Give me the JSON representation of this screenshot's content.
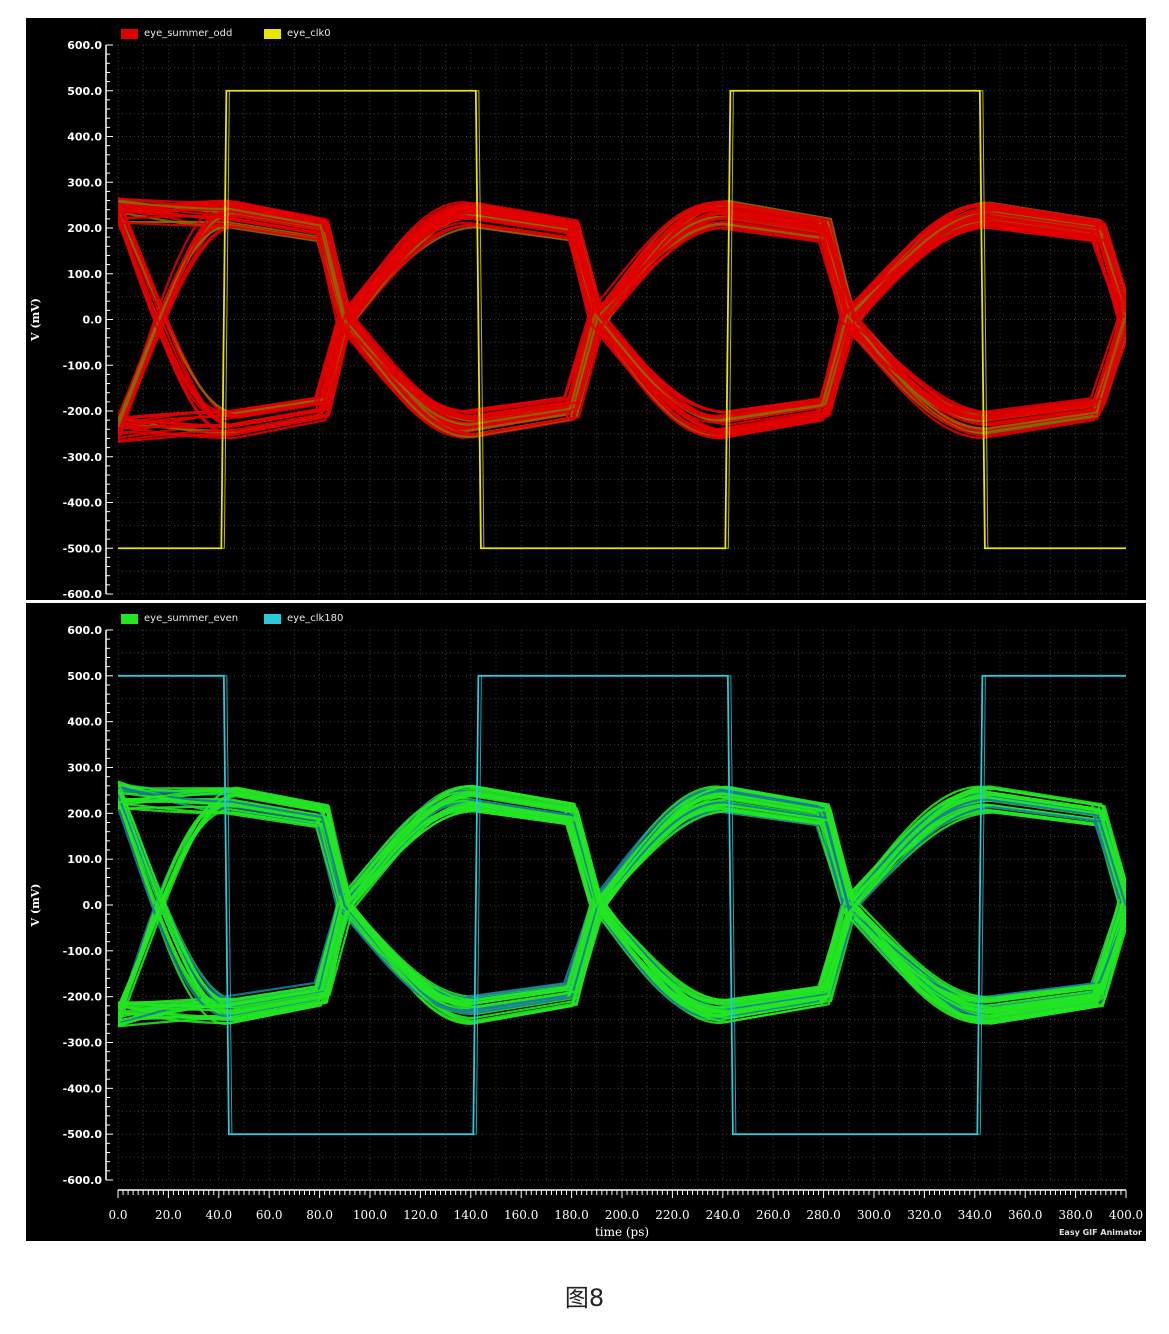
{
  "chart_data": [
    {
      "type": "line",
      "subtype": "eye-diagram",
      "ylabel": "V (mV)",
      "xlabel": "",
      "xlim": [
        0,
        400
      ],
      "ylim": [
        -600,
        600
      ],
      "y_ticks": [
        "600.0",
        "500.0",
        "400.0",
        "300.0",
        "200.0",
        "100.0",
        "0.0",
        "-100.0",
        "-200.0",
        "-300.0",
        "-400.0",
        "-500.0",
        "-600.0"
      ],
      "grid": true,
      "legend_position": "top-left",
      "series": [
        {
          "name": "eye_summer_odd",
          "color": "#e00000",
          "kind": "eye",
          "levels_mV": [
            -300,
            -200,
            200,
            300
          ],
          "crossings_ps": [
            0,
            90,
            190,
            290,
            400
          ],
          "crossing_level_mV": 0
        },
        {
          "name": "eye_clk0",
          "color": "#e6e600",
          "kind": "clock",
          "high_mV": 500,
          "low_mV": -500,
          "rising_edges_ps": [
            42,
            242
          ],
          "falling_edges_ps": [
            143,
            343
          ]
        }
      ]
    },
    {
      "type": "line",
      "subtype": "eye-diagram",
      "ylabel": "V (mV)",
      "xlabel": "time (ps)",
      "xlim": [
        0,
        400
      ],
      "ylim": [
        -600,
        600
      ],
      "x_ticks": [
        "0.0",
        "20.0",
        "40.0",
        "60.0",
        "80.0",
        "100.0",
        "120.0",
        "140.0",
        "160.0",
        "180.0",
        "200.0",
        "220.0",
        "240.0",
        "260.0",
        "280.0",
        "300.0",
        "320.0",
        "340.0",
        "360.0",
        "380.0",
        "400.0"
      ],
      "y_ticks": [
        "600.0",
        "500.0",
        "400.0",
        "300.0",
        "200.0",
        "100.0",
        "0.0",
        "-100.0",
        "-200.0",
        "-300.0",
        "-400.0",
        "-500.0",
        "-600.0"
      ],
      "grid": true,
      "legend_position": "top-left",
      "series": [
        {
          "name": "eye_summer_even",
          "color": "#22e622",
          "kind": "eye",
          "levels_mV": [
            -300,
            -200,
            200,
            300
          ],
          "crossings_ps": [
            0,
            90,
            190,
            290,
            400
          ],
          "crossing_level_mV": 0
        },
        {
          "name": "eye_clk180",
          "color": "#2ac8d8",
          "kind": "clock",
          "high_mV": 500,
          "low_mV": -500,
          "falling_edges_ps": [
            43,
            243
          ],
          "rising_edges_ps": [
            142,
            342
          ]
        }
      ]
    }
  ],
  "watermark": "Easy GIF Animator",
  "caption": "图8"
}
